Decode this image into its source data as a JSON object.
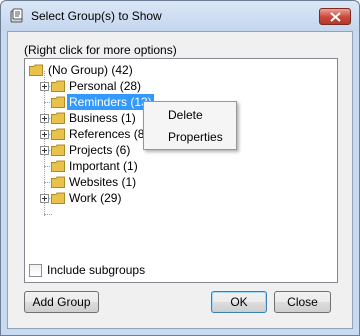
{
  "window": {
    "title": "Select Group(s) to Show",
    "icon": "groups-app-icon"
  },
  "hint": "(Right click for more options)",
  "tree": {
    "root": {
      "label": "(No Group) (42)"
    },
    "items": [
      {
        "label": "Personal (28)",
        "expandable": true,
        "selected": false
      },
      {
        "label": "Reminders (13)",
        "expandable": false,
        "selected": true
      },
      {
        "label": "Business (1)",
        "expandable": true,
        "selected": false
      },
      {
        "label": "References (8",
        "expandable": true,
        "selected": false
      },
      {
        "label": "Projects (6)",
        "expandable": true,
        "selected": false
      },
      {
        "label": "Important (1)",
        "expandable": false,
        "selected": false
      },
      {
        "label": "Websites (1)",
        "expandable": false,
        "selected": false
      },
      {
        "label": "Work (29)",
        "expandable": true,
        "selected": false
      }
    ]
  },
  "context_menu": {
    "items": [
      "Delete",
      "Properties"
    ]
  },
  "include_subgroups": {
    "label": "Include subgroups",
    "checked": false
  },
  "buttons": {
    "add_group": "Add Group",
    "ok": "OK",
    "close": "Close"
  },
  "colors": {
    "selection": "#3399ff",
    "folder": "#e8c24a",
    "close_button": "#c9463a"
  }
}
